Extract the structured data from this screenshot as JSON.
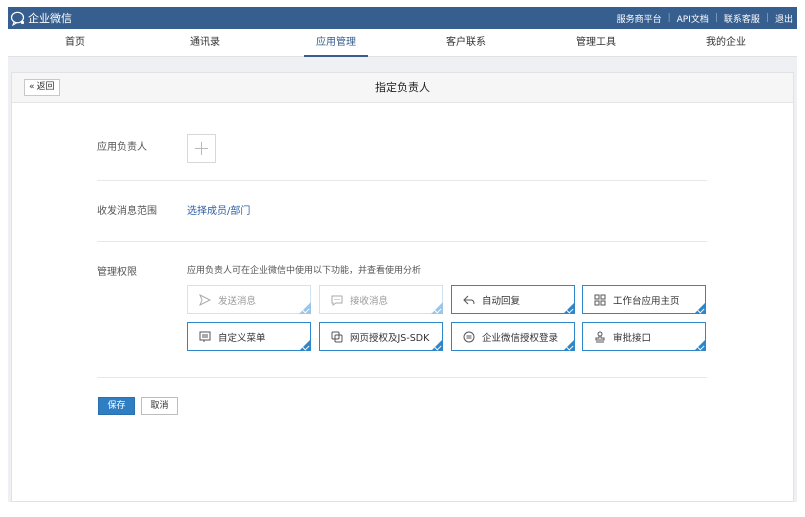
{
  "topbar": {
    "app_name": "企业微信",
    "links": [
      "服务商平台",
      "API文档",
      "联系客服",
      "退出"
    ],
    "background": "#365e8e"
  },
  "nav": {
    "items": [
      {
        "label": "首页",
        "active": false
      },
      {
        "label": "通讯录",
        "active": false
      },
      {
        "label": "应用管理",
        "active": true
      },
      {
        "label": "客户联系",
        "active": false
      },
      {
        "label": "管理工具",
        "active": false
      },
      {
        "label": "我的企业",
        "active": false
      }
    ]
  },
  "panel": {
    "back_label": "返回",
    "title": "指定负责人"
  },
  "form": {
    "owner_label": "应用负责人",
    "scope_label": "收发消息范围",
    "scope_link": "选择成员/部门",
    "perm_label": "管理权限",
    "perm_desc": "应用负责人可在企业微信中使用以下功能，并查看使用分析",
    "permissions": [
      {
        "label": "发送消息",
        "icon": "send-icon",
        "enabled": false
      },
      {
        "label": "接收消息",
        "icon": "message-icon",
        "enabled": false
      },
      {
        "label": "自动回复",
        "icon": "reply-icon",
        "enabled": true
      },
      {
        "label": "工作台应用主页",
        "icon": "grid-icon",
        "enabled": true
      },
      {
        "label": "自定义菜单",
        "icon": "menu-icon",
        "enabled": true
      },
      {
        "label": "网页授权及JS-SDK",
        "icon": "web-auth-icon",
        "enabled": true
      },
      {
        "label": "企业微信授权登录",
        "icon": "login-icon",
        "enabled": true
      },
      {
        "label": "审批接口",
        "icon": "stamp-icon",
        "enabled": true
      }
    ]
  },
  "actions": {
    "save": "保存",
    "cancel": "取消"
  },
  "colors": {
    "accent": "#2f7ec4",
    "link": "#2b5ea6"
  }
}
